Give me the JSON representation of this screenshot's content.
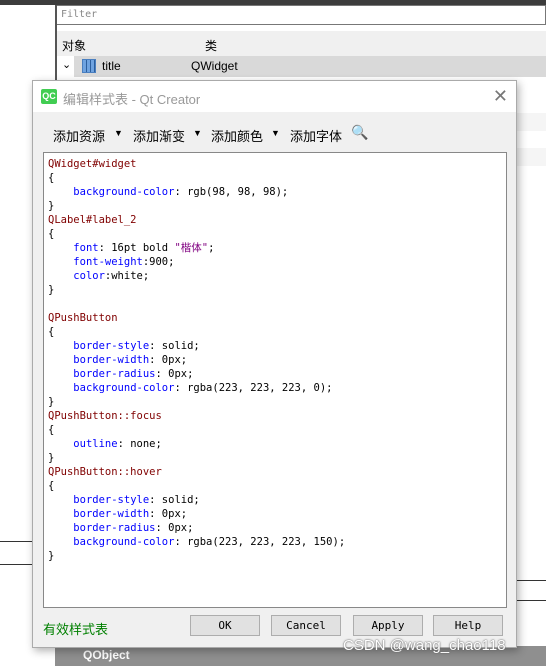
{
  "background": {
    "filter_placeholder": "Filter",
    "col_object": "对象",
    "col_class": "类",
    "row": {
      "name": "title",
      "class": "QWidget"
    },
    "bottom_row": "QObject"
  },
  "dialog": {
    "icon_text": "QC",
    "title": "编辑样式表 - Qt Creator",
    "toolbar": {
      "add_resource": "添加资源",
      "add_gradient": "添加渐变",
      "add_color": "添加颜色",
      "add_font": "添加字体"
    },
    "code": [
      [
        [
          "sel",
          "QWidget#widget"
        ]
      ],
      [
        [
          "val",
          "{"
        ]
      ],
      [
        [
          "val",
          "    "
        ],
        [
          "prop",
          "background-color"
        ],
        [
          "val",
          ": rgb(98, 98, 98);"
        ]
      ],
      [
        [
          "val",
          "}"
        ]
      ],
      [
        [
          "sel",
          "QLabel#label_2"
        ]
      ],
      [
        [
          "val",
          "{"
        ]
      ],
      [
        [
          "val",
          "    "
        ],
        [
          "prop",
          "font"
        ],
        [
          "val",
          ": 16pt bold "
        ],
        [
          "str",
          "\"楷体\""
        ],
        [
          "val",
          ";"
        ]
      ],
      [
        [
          "val",
          "    "
        ],
        [
          "prop",
          "font-weight"
        ],
        [
          "val",
          ":900;"
        ]
      ],
      [
        [
          "val",
          "    "
        ],
        [
          "prop",
          "color"
        ],
        [
          "val",
          ":white;"
        ]
      ],
      [
        [
          "val",
          "}"
        ]
      ],
      [
        [
          "val",
          ""
        ]
      ],
      [
        [
          "sel",
          "QPushButton"
        ]
      ],
      [
        [
          "val",
          "{"
        ]
      ],
      [
        [
          "val",
          "    "
        ],
        [
          "prop",
          "border-style"
        ],
        [
          "val",
          ": solid;"
        ]
      ],
      [
        [
          "val",
          "    "
        ],
        [
          "prop",
          "border-width"
        ],
        [
          "val",
          ": 0px;"
        ]
      ],
      [
        [
          "val",
          "    "
        ],
        [
          "prop",
          "border-radius"
        ],
        [
          "val",
          ": 0px;"
        ]
      ],
      [
        [
          "val",
          "    "
        ],
        [
          "prop",
          "background-color"
        ],
        [
          "val",
          ": rgba(223, 223, 223, 0);"
        ]
      ],
      [
        [
          "val",
          "}"
        ]
      ],
      [
        [
          "sel",
          "QPushButton::focus"
        ]
      ],
      [
        [
          "val",
          "{"
        ]
      ],
      [
        [
          "val",
          "    "
        ],
        [
          "prop",
          "outline"
        ],
        [
          "val",
          ": none;"
        ]
      ],
      [
        [
          "val",
          "}"
        ]
      ],
      [
        [
          "sel",
          "QPushButton::hover"
        ]
      ],
      [
        [
          "val",
          "{"
        ]
      ],
      [
        [
          "val",
          "    "
        ],
        [
          "prop",
          "border-style"
        ],
        [
          "val",
          ": solid;"
        ]
      ],
      [
        [
          "val",
          "    "
        ],
        [
          "prop",
          "border-width"
        ],
        [
          "val",
          ": 0px;"
        ]
      ],
      [
        [
          "val",
          "    "
        ],
        [
          "prop",
          "border-radius"
        ],
        [
          "val",
          ": 0px;"
        ]
      ],
      [
        [
          "val",
          "    "
        ],
        [
          "prop",
          "background-color"
        ],
        [
          "val",
          ": rgba(223, 223, 223, 150);"
        ]
      ],
      [
        [
          "val",
          "}"
        ]
      ]
    ],
    "status": "有效样式表",
    "buttons": {
      "ok": "OK",
      "cancel": "Cancel",
      "apply": "Apply",
      "help": "Help"
    }
  },
  "watermark": "CSDN @wang_chao118",
  "colors": {
    "selector": "#800000",
    "property": "#0000ff",
    "string": "#800080",
    "status": "#008000"
  }
}
